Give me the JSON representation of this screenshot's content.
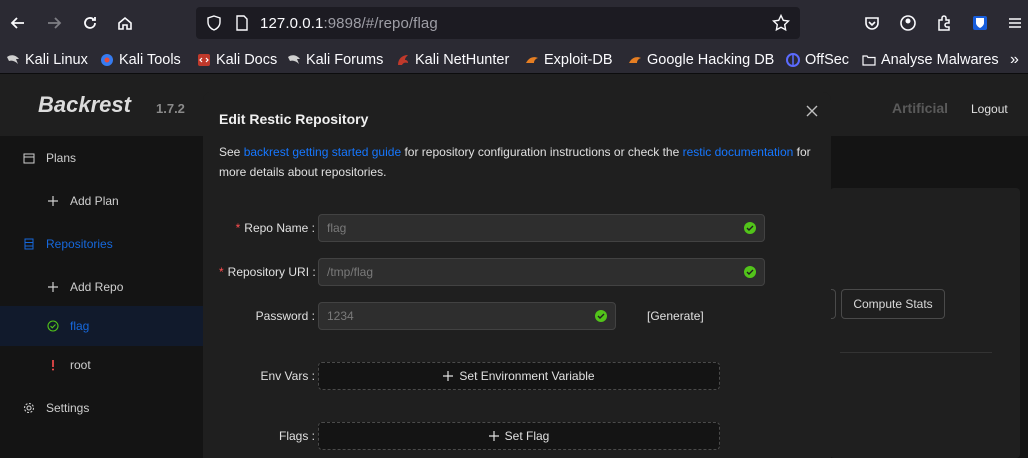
{
  "browser": {
    "url_host": "127.0.0.1",
    "url_rest": ":9898/#/repo/flag"
  },
  "bookmarks": [
    {
      "label": "Kali Linux",
      "color": "#367bf0"
    },
    {
      "label": "Kali Tools",
      "color": "#367bf0"
    },
    {
      "label": "Kali Docs",
      "color": "#c0392b"
    },
    {
      "label": "Kali Forums",
      "color": "#367bf0"
    },
    {
      "label": "Kali NetHunter",
      "color": "#c0392b"
    },
    {
      "label": "Exploit-DB",
      "color": "#e67e22"
    },
    {
      "label": "Google Hacking DB",
      "color": "#e67e22"
    },
    {
      "label": "OffSec",
      "color": "#5b6bff"
    },
    {
      "label": "Analyse Malwares",
      "color": "#fbfbfe"
    }
  ],
  "header": {
    "logo": "Backrest",
    "version": "1.7.2",
    "user": "Artificial",
    "logout": "Logout"
  },
  "sidebar": {
    "plans": "Plans",
    "add_plan": "Add Plan",
    "repositories": "Repositories",
    "add_repo": "Add Repo",
    "repo_flag": "flag",
    "repo_root": "root",
    "settings": "Settings"
  },
  "content": {
    "compute_stats": "Compute Stats"
  },
  "modal": {
    "title": "Edit Restic Repository",
    "desc_prefix": "See ",
    "desc_link1": "backrest getting started guide",
    "desc_mid": " for repository configuration instructions or check the ",
    "desc_link2": "restic documentation",
    "desc_suffix": " for more details about repositories.",
    "repo_name_label": "Repo Name",
    "repo_name_value": "flag",
    "repo_uri_label": "Repository URI",
    "repo_uri_value": "/tmp/flag",
    "password_label": "Password",
    "password_value": "1234",
    "generate": "[Generate]",
    "env_vars_label": "Env Vars",
    "env_vars_button": "Set Environment Variable",
    "flags_label": "Flags",
    "flags_button": "Set Flag"
  }
}
